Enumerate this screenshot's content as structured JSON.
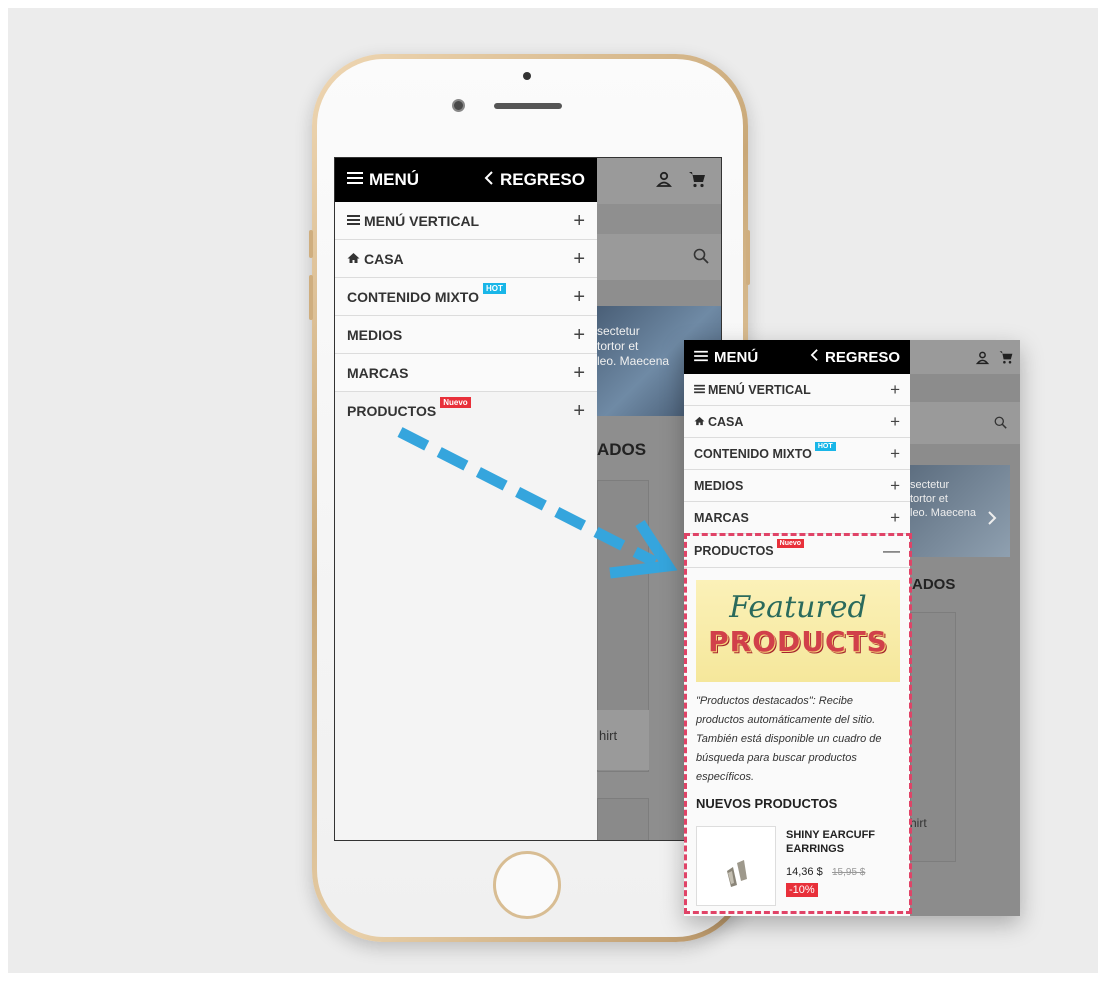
{
  "menu": {
    "title": "MENÚ",
    "back_label": "REGRESO",
    "items": [
      {
        "label": "MENÚ VERTICAL",
        "toggle": "+"
      },
      {
        "label": "CASA",
        "toggle": "+"
      },
      {
        "label": "CONTENIDO MIXTO",
        "badge": "HOT",
        "toggle": "+"
      },
      {
        "label": "MEDIOS",
        "toggle": "+"
      },
      {
        "label": "MARCAS",
        "toggle": "+"
      },
      {
        "label": "PRODUCTOS",
        "badge": "Nuevo",
        "toggle": "+"
      }
    ]
  },
  "background_page": {
    "banner_text": "sectetur\ntortor et\nleo. Maecena",
    "section_heading": "ADOS",
    "card_label": "hirt"
  },
  "zoomed": {
    "expanded_toggle": "—",
    "banner_line1": "Featured",
    "banner_line2": "PRODUCTS",
    "description": "\"Productos destacados\": Recibe productos automáticamente del sitio. También está disponible un cuadro de búsqueda para buscar productos específicos.",
    "new_products_title": "NUEVOS PRODUCTOS",
    "product": {
      "name": "SHINY EARCUFF EARRINGS",
      "price": "14,36 $",
      "old_price": "15,95 $",
      "discount": "-10%"
    },
    "bg_banner_text": "sectetur\ntortor et\nleo. Maecena",
    "bg_heading": "ADOS",
    "bg_card_label": "hirt"
  },
  "colors": {
    "hot_badge": "#19b6e8",
    "new_badge": "#e8303a",
    "highlight_dash": "#e04367",
    "arrow": "#35a5dd"
  }
}
